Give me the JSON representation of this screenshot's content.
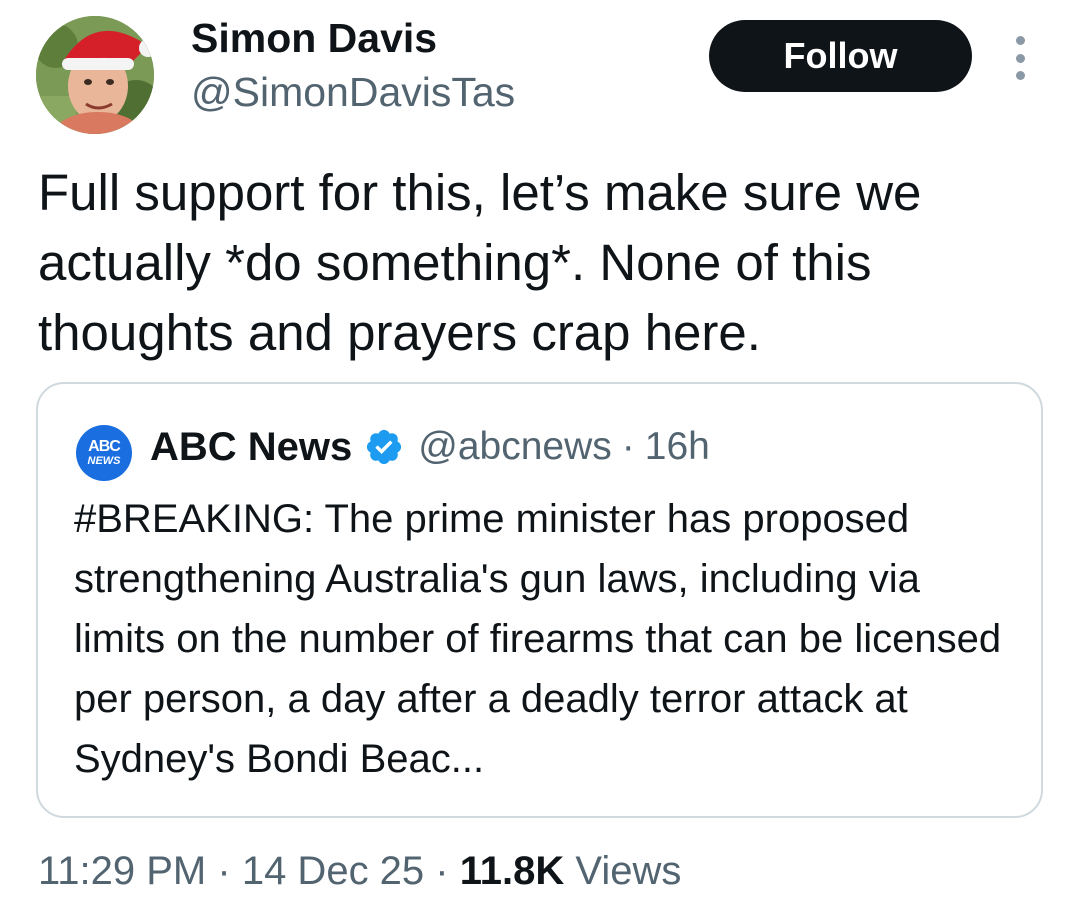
{
  "author": {
    "name": "Simon Davis",
    "handle": "@SimonDavisTas",
    "avatar_icon": "avatar-santa-hat"
  },
  "follow_label": "Follow",
  "more_icon": "more-vertical-icon",
  "tweet": {
    "text": "Full support for this, let’s make sure we actually *do something*. None of this thoughts and prayers crap here."
  },
  "quote": {
    "logo_icon": "abc-news-logo",
    "logo_top": "ABC",
    "logo_bottom": "NEWS",
    "name": "ABC News",
    "verified_icon": "verified-badge-icon",
    "handle": "@abcnews",
    "separator": "·",
    "time": "16h",
    "text": "#BREAKING: The prime minister has proposed strengthening Australia's gun laws, including via limits on the number of firearms that can be licensed per person, a day after a deadly terror attack at Sydney's Bondi Beac..."
  },
  "meta": {
    "time": "11:29 PM",
    "sep1": "·",
    "date": "14 Dec 25",
    "sep2": "·",
    "views_count": "11.8K",
    "views_label": "Views"
  },
  "colors": {
    "text_primary": "#0f1419",
    "text_secondary": "#536471",
    "follow_bg": "#0f1419",
    "border": "#cfd9de",
    "verified": "#1d9bf0",
    "abc_blue": "#1a6ee0"
  }
}
